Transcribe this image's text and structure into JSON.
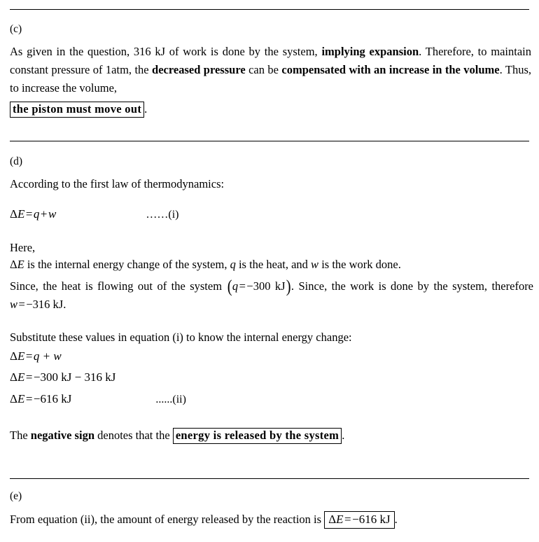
{
  "document": {
    "sections": [
      {
        "label": "(c)",
        "paragraph": {
          "t1": "As given in the question, 316 kJ of work is done by the system, ",
          "b1": "implying expansion",
          "t2": ". Therefore, to maintain constant pressure of 1atm, the ",
          "b2": "decreased pressure",
          "t3": " can be ",
          "b3": "compensated with an increase in the volume",
          "t4": ". Thus, to increase the volume, "
        },
        "boxed_answer": "the piston must move out",
        "trailing": "."
      },
      {
        "label": "(d)",
        "intro": "According to the first law of thermodynamics:",
        "equation_i": {
          "delta": "Δ",
          "E": "E",
          "eq": "=",
          "q": "q",
          "plus": "+",
          "w": "w",
          "ref": "……(i)"
        },
        "here_label": "Here,",
        "definition": {
          "delta": "Δ",
          "E": "E",
          "t1": " is the internal energy change of the system, ",
          "q": "q",
          "t2": " is the heat, and ",
          "w": "w",
          "t3": " is the work done."
        },
        "heat_sentence": {
          "t1": "Since, the heat is flowing out of the system ",
          "paren_open": "(",
          "q": "q",
          "eq": "=",
          "value": "−300 kJ",
          "paren_close": ")",
          "t2": ". Since, the work is done by the system, therefore ",
          "w": "w",
          "eq2": "=",
          "value2": "−316 kJ",
          "t3": "."
        },
        "substitute_intro": "Substitute these values in equation (i) to know the internal energy change:",
        "steps": [
          {
            "lhs_delta": "Δ",
            "lhs_E": "E",
            "eq": "=",
            "rhs": "q + w",
            "rhs_italic": true,
            "ref": ""
          },
          {
            "lhs_delta": "Δ",
            "lhs_E": "E",
            "eq": "=",
            "rhs": "−300 kJ − 316 kJ",
            "rhs_italic": false,
            "ref": ""
          },
          {
            "lhs_delta": "Δ",
            "lhs_E": "E",
            "eq": "=",
            "rhs": "−616 kJ",
            "rhs_italic": false,
            "ref": "......(ii)"
          }
        ],
        "conclusion": {
          "t1": "The ",
          "b1": "negative sign",
          "t2": " denotes that the ",
          "boxed": "energy is released by the system",
          "t3": "."
        }
      },
      {
        "label": "(e)",
        "final": {
          "t1": "From equation (ii), the amount of energy released by the reaction is ",
          "boxed_delta": "Δ",
          "boxed_E": "E",
          "boxed_eq": "=",
          "boxed_value": "−616 kJ",
          "t2": "."
        }
      }
    ]
  }
}
